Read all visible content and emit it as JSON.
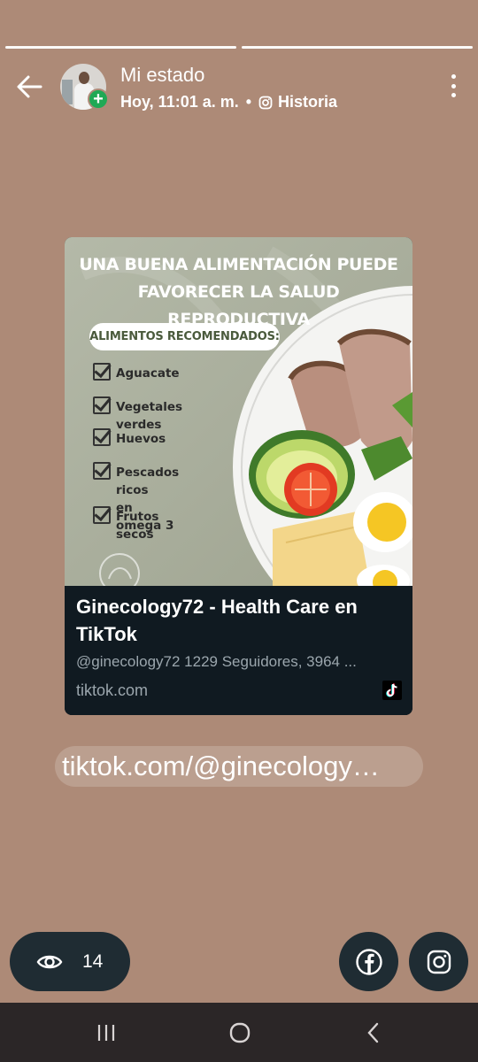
{
  "status": {
    "title": "Mi estado",
    "time": "Hoy, 11:01 a. m.",
    "separator": "•",
    "source": "Historia",
    "segments_total": 2,
    "segments_viewed": 2
  },
  "link_preview": {
    "poster": {
      "headline_line1": "UNA BUENA ALIMENTACIÓN PUEDE",
      "headline_line2": "FAVORECER LA SALUD REPRODUCTIVA",
      "list_title": "ALIMENTOS RECOMENDADOS:",
      "items": [
        "Aguacate",
        "Vegetales verdes",
        "Huevos",
        "Pescados ricos\nen omega 3",
        "Frutos secos"
      ]
    },
    "title": "Ginecology72 - Health Care en TikTok",
    "description": "@ginecology72 1229 Seguidores, 3964 ...",
    "domain": "tiktok.com"
  },
  "link_text": "tiktok.com/@ginecology…",
  "views": {
    "count": "14"
  },
  "colors": {
    "background": "#ad8a77",
    "pill_dark": "#1f2c33",
    "add_badge": "#1fa955",
    "navbar": "#2b2627"
  },
  "icons": [
    "back-arrow-icon",
    "plus-icon",
    "instagram-icon",
    "more-vert-icon",
    "check-icon",
    "tiktok-icon",
    "eye-icon",
    "facebook-icon",
    "recents-icon",
    "home-icon",
    "nav-back-icon"
  ]
}
